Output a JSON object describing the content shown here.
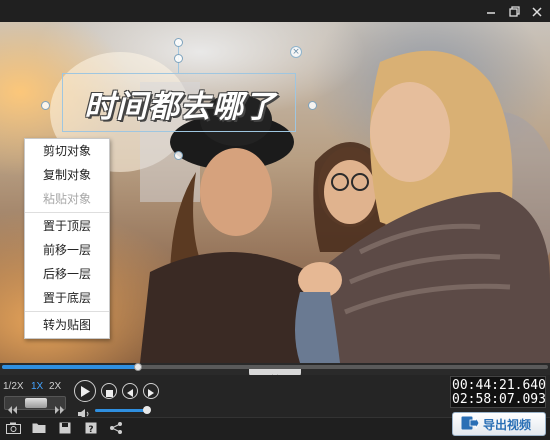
{
  "window": {
    "minimize_icon": "minimize-icon",
    "maximize_icon": "restore-icon",
    "close_icon": "close-icon"
  },
  "text_object": {
    "text": "时间都去哪了",
    "close_icon": "close-icon"
  },
  "context_menu": {
    "items": [
      {
        "label": "剪切对象",
        "enabled": true
      },
      {
        "label": "复制对象",
        "enabled": true
      },
      {
        "label": "粘贴对象",
        "enabled": false
      },
      {
        "label": "置于顶层",
        "enabled": true
      },
      {
        "label": "前移一层",
        "enabled": true
      },
      {
        "label": "后移一层",
        "enabled": true
      },
      {
        "label": "置于底层",
        "enabled": true
      },
      {
        "label": "转为贴图",
        "enabled": true
      }
    ]
  },
  "playback": {
    "progress": 0.25,
    "speeds": [
      "1/2X",
      "1X",
      "2X"
    ],
    "active_speed": "1X",
    "volume": 0.9,
    "current_time": "00:44:21.640",
    "total_time": "02:58:07.093"
  },
  "toolbar": {
    "icons": [
      "camera-icon",
      "folder-open-icon",
      "save-icon",
      "help-icon",
      "share-icon"
    ],
    "export_label": "导出视频"
  },
  "colors": {
    "accent": "#2f8fe0",
    "active_speed": "#44a4ff"
  }
}
